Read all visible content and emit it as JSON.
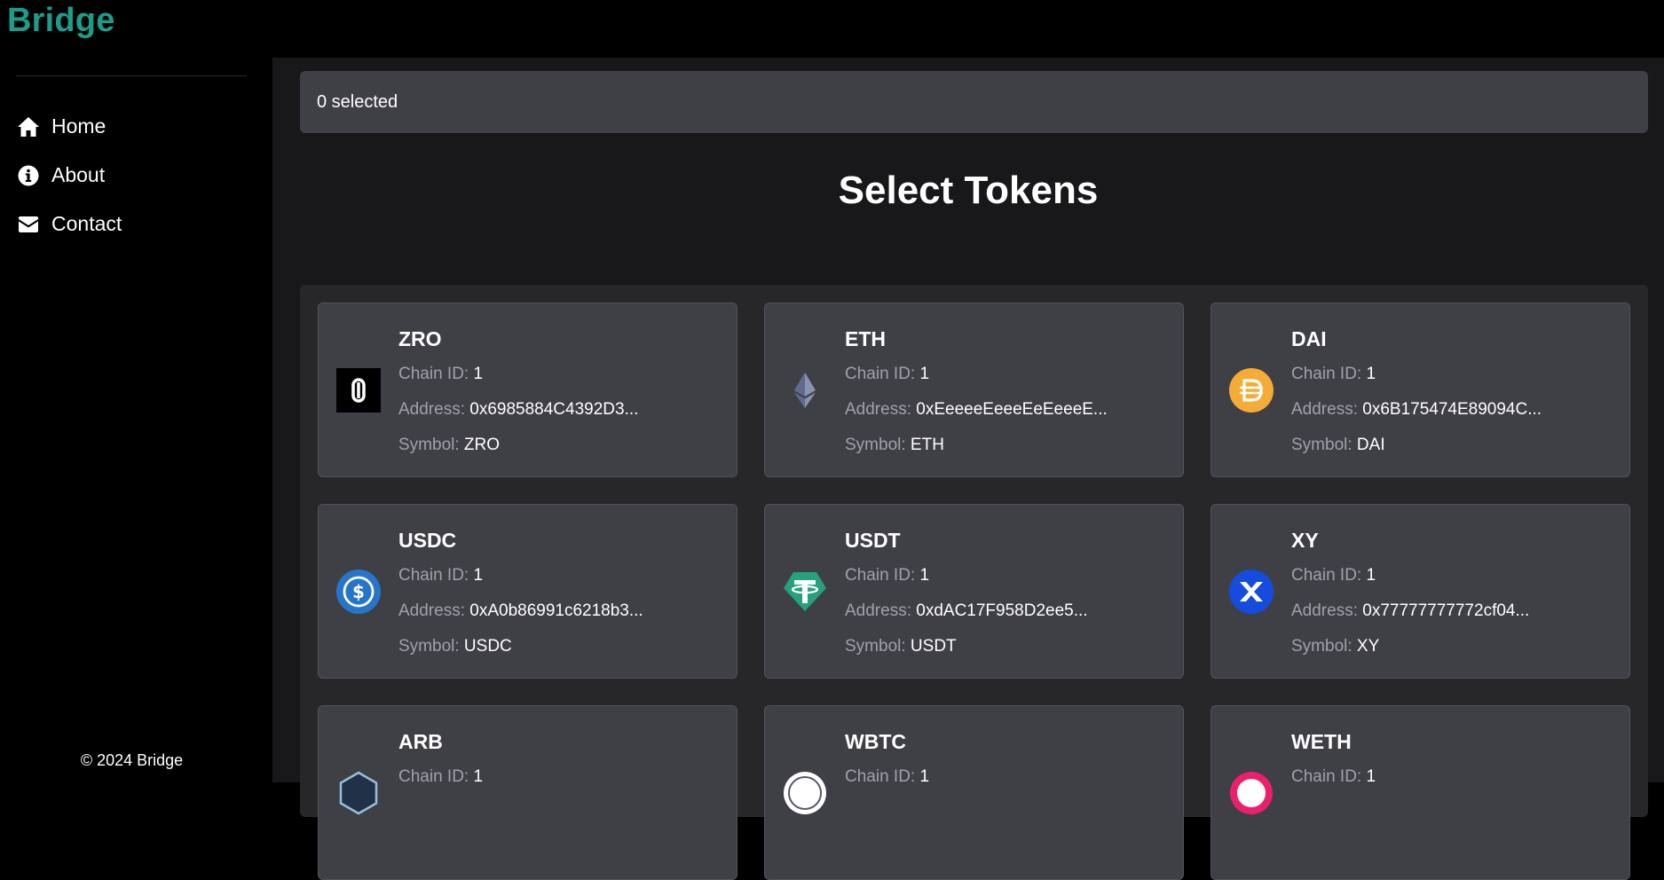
{
  "brand": "Bridge",
  "nav": [
    {
      "label": "Home",
      "icon": "home-icon"
    },
    {
      "label": "About",
      "icon": "info-icon"
    },
    {
      "label": "Contact",
      "icon": "mail-icon"
    }
  ],
  "footer": "© 2024 Bridge",
  "selection": {
    "text": "0 selected"
  },
  "page_title": "Select Tokens",
  "labels": {
    "chain_id": "Chain ID:",
    "address": "Address:",
    "symbol": "Symbol:"
  },
  "tokens": [
    {
      "name": "ZRO",
      "chain_id": "1",
      "address": "0x6985884C4392D3...",
      "symbol": "ZRO",
      "icon": "zro-logo-icon",
      "color": "#000000"
    },
    {
      "name": "ETH",
      "chain_id": "1",
      "address": "0xEeeeeEeeeEeEeeeE...",
      "symbol": "ETH",
      "icon": "eth-logo-icon",
      "color": "#8a92b2"
    },
    {
      "name": "DAI",
      "chain_id": "1",
      "address": "0x6B175474E89094C...",
      "symbol": "DAI",
      "icon": "dai-logo-icon",
      "color": "#f5ac37"
    },
    {
      "name": "USDC",
      "chain_id": "1",
      "address": "0xA0b86991c6218b3...",
      "symbol": "USDC",
      "icon": "usdc-logo-icon",
      "color": "#2775ca"
    },
    {
      "name": "USDT",
      "chain_id": "1",
      "address": "0xdAC17F958D2ee5...",
      "symbol": "USDT",
      "icon": "usdt-logo-icon",
      "color": "#26a17b"
    },
    {
      "name": "XY",
      "chain_id": "1",
      "address": "0x77777777772cf04...",
      "symbol": "XY",
      "icon": "xy-logo-icon",
      "color": "#1a5cff"
    },
    {
      "name": "ARB",
      "chain_id": "1",
      "address": "",
      "symbol": "",
      "icon": "arb-logo-icon",
      "color": "#96bedc"
    },
    {
      "name": "WBTC",
      "chain_id": "1",
      "address": "",
      "symbol": "",
      "icon": "wbtc-logo-icon",
      "color": "#ffffff"
    },
    {
      "name": "WETH",
      "chain_id": "1",
      "address": "",
      "symbol": "",
      "icon": "weth-logo-icon",
      "color": "#ec1f6e"
    }
  ]
}
